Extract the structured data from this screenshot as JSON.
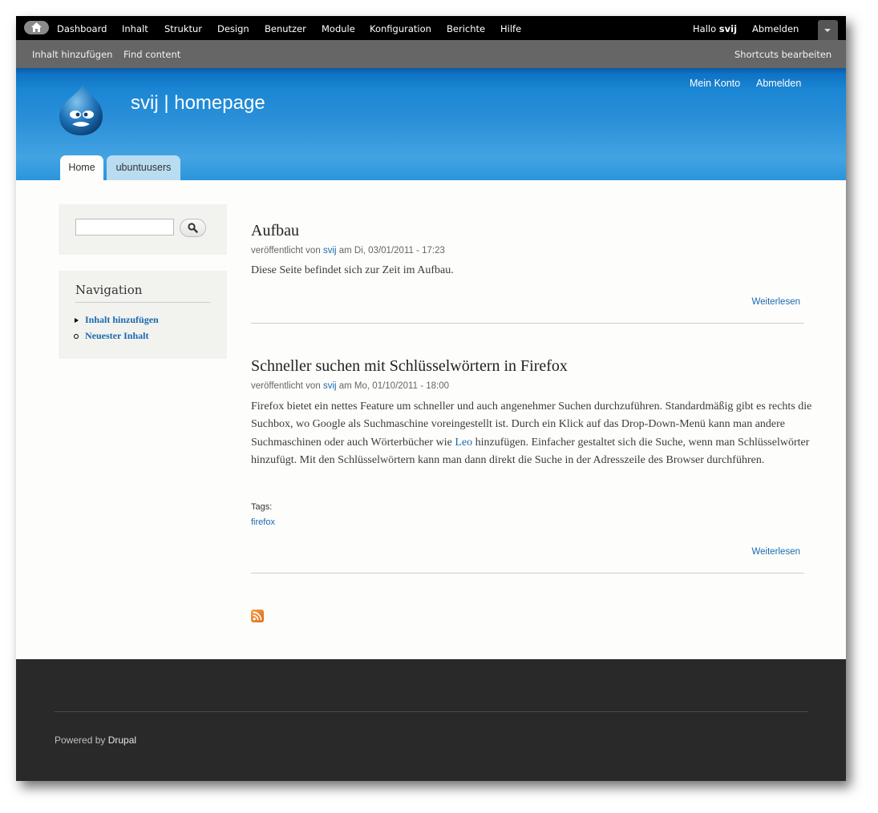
{
  "toolbar": {
    "menu": [
      "Dashboard",
      "Inhalt",
      "Struktur",
      "Design",
      "Benutzer",
      "Module",
      "Konfiguration",
      "Berichte",
      "Hilfe"
    ],
    "hello_prefix": "Hallo ",
    "username": "svij",
    "logout": "Abmelden"
  },
  "shortcuts": {
    "items": [
      "Inhalt hinzufügen",
      "Find content"
    ],
    "edit": "Shortcuts bearbeiten"
  },
  "header": {
    "site_name": "svij | homepage",
    "secondary": [
      "Mein Konto",
      "Abmelden"
    ],
    "tabs": [
      {
        "label": "Home",
        "active": true
      },
      {
        "label": "ubuntuusers",
        "active": false
      }
    ]
  },
  "sidebar": {
    "search": {
      "placeholder": ""
    },
    "navigation": {
      "title": "Navigation",
      "items": [
        "Inhalt hinzufügen",
        "Neuester Inhalt"
      ]
    }
  },
  "nodes": [
    {
      "title": "Aufbau",
      "meta_prefix": "veröffentlicht von ",
      "author": "svij",
      "meta_suffix": " am Di, 03/01/2011 - 17:23",
      "body": "Diese Seite befindet sich zur Zeit im Aufbau.",
      "readmore": "Weiterlesen"
    },
    {
      "title": "Schneller suchen mit Schlüsselwörtern in Firefox",
      "meta_prefix": "veröffentlicht von ",
      "author": "svij",
      "meta_suffix": " am Mo, 01/10/2011 - 18:00",
      "body_before": "Firefox bietet ein nettes Feature um schneller und auch angenehmer Suchen durchzuführen. Standardmäßig gibt es rechts die Suchbox, wo Google als Suchmaschine voreingestellt ist. Durch ein Klick auf das Drop-Down-Menü kann man andere Suchmaschinen oder auch Wörterbücher wie ",
      "body_link": "Leo",
      "body_after": " hinzufügen. Einfacher gestaltet sich die Suche, wenn man Schlüsselwörter hinzufügt. Mit den Schlüsselwörtern kann man dann direkt die Suche in der Adresszeile des Browser durchführen.",
      "tags_label": "Tags:",
      "tag": "firefox",
      "readmore": "Weiterlesen"
    }
  ],
  "footer": {
    "powered_prefix": "Powered by ",
    "powered_link": "Drupal"
  },
  "icons": {
    "home": "home-icon",
    "search": "search-icon",
    "rss": "rss-feed-icon",
    "logo": "drupal-logo"
  },
  "colors": {
    "link": "#1a6ab0",
    "header_blue": "#2a8fd8",
    "footer": "#292929"
  }
}
